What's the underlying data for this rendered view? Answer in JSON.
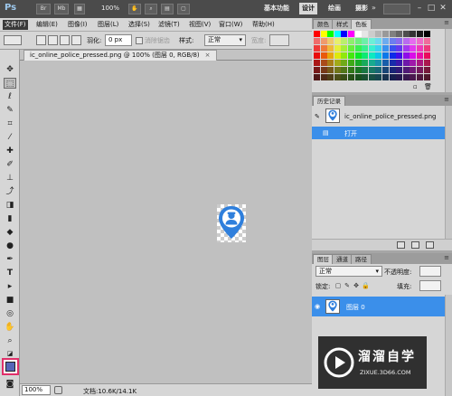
{
  "app": {
    "logo": "Ps",
    "app_buttons": [
      "Br",
      "Mb"
    ],
    "zoom": "100%",
    "workspaces": [
      "基本功能",
      "设计",
      "绘画",
      "摄影"
    ],
    "active_workspace": "设计",
    "more": "»"
  },
  "menu": [
    "文件(F)",
    "编辑(E)",
    "图像(I)",
    "图层(L)",
    "选择(S)",
    "滤镜(T)",
    "视图(V)",
    "窗口(W)",
    "帮助(H)"
  ],
  "options": {
    "feather_label": "羽化:",
    "feather_value": "0 px",
    "antialias_label": "消除锯齿",
    "style_label": "样式:",
    "style_value": "正常",
    "width_label": "宽度:"
  },
  "document": {
    "tab_title": "ic_online_police_pressed.png @ 100% (图层 0, RGB/8)",
    "tab_close": "×",
    "zoom": "100%",
    "doc_info": "文档:10.6K/14.1K"
  },
  "panels": {
    "swatches_tabs": [
      "颜色",
      "样式",
      "色板"
    ],
    "history_tab": "历史记录",
    "history_items": [
      {
        "label": "ic_online_police_pressed.png"
      },
      {
        "label": "打开"
      }
    ],
    "layers_tabs": [
      "图层",
      "通道",
      "路径"
    ],
    "blend_mode": "正常",
    "opacity_label": "不透明度:",
    "lock_label": "锁定:",
    "fill_label": "填充:",
    "layer_name": "图层 0"
  },
  "watermark": {
    "title": "溜溜自学",
    "url": "ZIXUE.3D66.COM"
  },
  "colors": {
    "accent": "#3b8fea",
    "pin": "#2f7fdc",
    "foreground": "#5666b8"
  }
}
